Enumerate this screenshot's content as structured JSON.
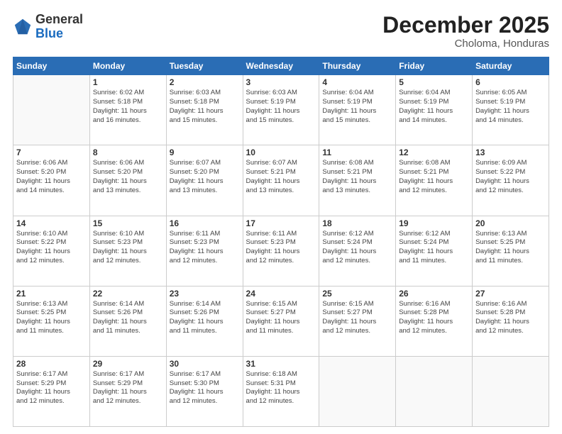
{
  "logo": {
    "general": "General",
    "blue": "Blue"
  },
  "header": {
    "month": "December 2025",
    "location": "Choloma, Honduras"
  },
  "weekdays": [
    "Sunday",
    "Monday",
    "Tuesday",
    "Wednesday",
    "Thursday",
    "Friday",
    "Saturday"
  ],
  "weeks": [
    [
      {
        "day": "",
        "info": ""
      },
      {
        "day": "1",
        "info": "Sunrise: 6:02 AM\nSunset: 5:18 PM\nDaylight: 11 hours\nand 16 minutes."
      },
      {
        "day": "2",
        "info": "Sunrise: 6:03 AM\nSunset: 5:18 PM\nDaylight: 11 hours\nand 15 minutes."
      },
      {
        "day": "3",
        "info": "Sunrise: 6:03 AM\nSunset: 5:19 PM\nDaylight: 11 hours\nand 15 minutes."
      },
      {
        "day": "4",
        "info": "Sunrise: 6:04 AM\nSunset: 5:19 PM\nDaylight: 11 hours\nand 15 minutes."
      },
      {
        "day": "5",
        "info": "Sunrise: 6:04 AM\nSunset: 5:19 PM\nDaylight: 11 hours\nand 14 minutes."
      },
      {
        "day": "6",
        "info": "Sunrise: 6:05 AM\nSunset: 5:19 PM\nDaylight: 11 hours\nand 14 minutes."
      }
    ],
    [
      {
        "day": "7",
        "info": "Sunrise: 6:06 AM\nSunset: 5:20 PM\nDaylight: 11 hours\nand 14 minutes."
      },
      {
        "day": "8",
        "info": "Sunrise: 6:06 AM\nSunset: 5:20 PM\nDaylight: 11 hours\nand 13 minutes."
      },
      {
        "day": "9",
        "info": "Sunrise: 6:07 AM\nSunset: 5:20 PM\nDaylight: 11 hours\nand 13 minutes."
      },
      {
        "day": "10",
        "info": "Sunrise: 6:07 AM\nSunset: 5:21 PM\nDaylight: 11 hours\nand 13 minutes."
      },
      {
        "day": "11",
        "info": "Sunrise: 6:08 AM\nSunset: 5:21 PM\nDaylight: 11 hours\nand 13 minutes."
      },
      {
        "day": "12",
        "info": "Sunrise: 6:08 AM\nSunset: 5:21 PM\nDaylight: 11 hours\nand 12 minutes."
      },
      {
        "day": "13",
        "info": "Sunrise: 6:09 AM\nSunset: 5:22 PM\nDaylight: 11 hours\nand 12 minutes."
      }
    ],
    [
      {
        "day": "14",
        "info": "Sunrise: 6:10 AM\nSunset: 5:22 PM\nDaylight: 11 hours\nand 12 minutes."
      },
      {
        "day": "15",
        "info": "Sunrise: 6:10 AM\nSunset: 5:23 PM\nDaylight: 11 hours\nand 12 minutes."
      },
      {
        "day": "16",
        "info": "Sunrise: 6:11 AM\nSunset: 5:23 PM\nDaylight: 11 hours\nand 12 minutes."
      },
      {
        "day": "17",
        "info": "Sunrise: 6:11 AM\nSunset: 5:23 PM\nDaylight: 11 hours\nand 12 minutes."
      },
      {
        "day": "18",
        "info": "Sunrise: 6:12 AM\nSunset: 5:24 PM\nDaylight: 11 hours\nand 12 minutes."
      },
      {
        "day": "19",
        "info": "Sunrise: 6:12 AM\nSunset: 5:24 PM\nDaylight: 11 hours\nand 11 minutes."
      },
      {
        "day": "20",
        "info": "Sunrise: 6:13 AM\nSunset: 5:25 PM\nDaylight: 11 hours\nand 11 minutes."
      }
    ],
    [
      {
        "day": "21",
        "info": "Sunrise: 6:13 AM\nSunset: 5:25 PM\nDaylight: 11 hours\nand 11 minutes."
      },
      {
        "day": "22",
        "info": "Sunrise: 6:14 AM\nSunset: 5:26 PM\nDaylight: 11 hours\nand 11 minutes."
      },
      {
        "day": "23",
        "info": "Sunrise: 6:14 AM\nSunset: 5:26 PM\nDaylight: 11 hours\nand 11 minutes."
      },
      {
        "day": "24",
        "info": "Sunrise: 6:15 AM\nSunset: 5:27 PM\nDaylight: 11 hours\nand 11 minutes."
      },
      {
        "day": "25",
        "info": "Sunrise: 6:15 AM\nSunset: 5:27 PM\nDaylight: 11 hours\nand 12 minutes."
      },
      {
        "day": "26",
        "info": "Sunrise: 6:16 AM\nSunset: 5:28 PM\nDaylight: 11 hours\nand 12 minutes."
      },
      {
        "day": "27",
        "info": "Sunrise: 6:16 AM\nSunset: 5:28 PM\nDaylight: 11 hours\nand 12 minutes."
      }
    ],
    [
      {
        "day": "28",
        "info": "Sunrise: 6:17 AM\nSunset: 5:29 PM\nDaylight: 11 hours\nand 12 minutes."
      },
      {
        "day": "29",
        "info": "Sunrise: 6:17 AM\nSunset: 5:29 PM\nDaylight: 11 hours\nand 12 minutes."
      },
      {
        "day": "30",
        "info": "Sunrise: 6:17 AM\nSunset: 5:30 PM\nDaylight: 11 hours\nand 12 minutes."
      },
      {
        "day": "31",
        "info": "Sunrise: 6:18 AM\nSunset: 5:31 PM\nDaylight: 11 hours\nand 12 minutes."
      },
      {
        "day": "",
        "info": ""
      },
      {
        "day": "",
        "info": ""
      },
      {
        "day": "",
        "info": ""
      }
    ]
  ]
}
